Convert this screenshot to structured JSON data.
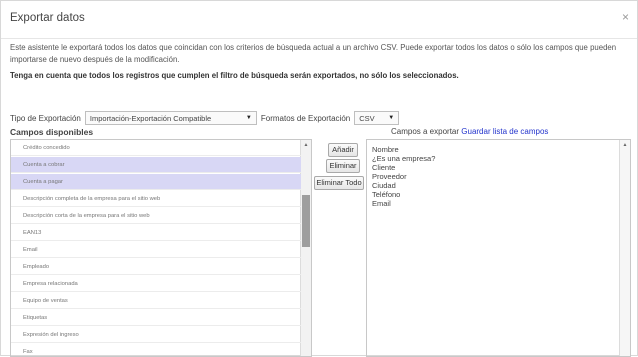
{
  "dialog": {
    "title": "Exportar datos",
    "close_icon": "×",
    "description": "Este asistente le exportará todos los datos que coincidan con los criterios de búsqueda actual a un archivo CSV. Puede exportar todos los datos o sólo los campos que pueden importarse de nuevo después de la modificación.",
    "warning": "Tenga en cuenta que todos los registros que cumplen el filtro de búsqueda serán exportados, no sólo los seleccionados."
  },
  "options": {
    "export_type_label": "Tipo de Exportación",
    "export_type_value": "Importación-Exportación Compatible",
    "format_label": "Formatos de Exportación",
    "format_value": "CSV"
  },
  "available": {
    "label": "Campos disponibles",
    "items": [
      {
        "label": "Crédito concedido",
        "selected": false
      },
      {
        "label": "Cuenta a cobrar",
        "selected": true
      },
      {
        "label": "Cuenta a pagar",
        "selected": true
      },
      {
        "label": "Descripción completa de la empresa para el sitio web",
        "selected": false
      },
      {
        "label": "Descripción corta de la empresa para el sitio web",
        "selected": false
      },
      {
        "label": "EAN13",
        "selected": false
      },
      {
        "label": "Email",
        "selected": false
      },
      {
        "label": "Empleado",
        "selected": false
      },
      {
        "label": "Empresa relacionada",
        "selected": false
      },
      {
        "label": "Equipo de ventas",
        "selected": false
      },
      {
        "label": "Etiquetas",
        "selected": false
      },
      {
        "label": "Expresión del ingreso",
        "selected": false
      },
      {
        "label": "Fax",
        "selected": false
      }
    ]
  },
  "buttons": {
    "add": "Añadir",
    "remove": "Eliminar",
    "remove_all": "Eliminar Todo"
  },
  "export_fields": {
    "label": "Campos a exportar",
    "save_link": "Guardar lista de campos",
    "items": [
      "Nombre",
      "¿Es una empresa?",
      "Cliente",
      "Proveedor",
      "Ciudad",
      "Teléfono",
      "Email"
    ]
  },
  "colors": {
    "selected_row": "#d8d7f5",
    "link": "#2233cc"
  }
}
